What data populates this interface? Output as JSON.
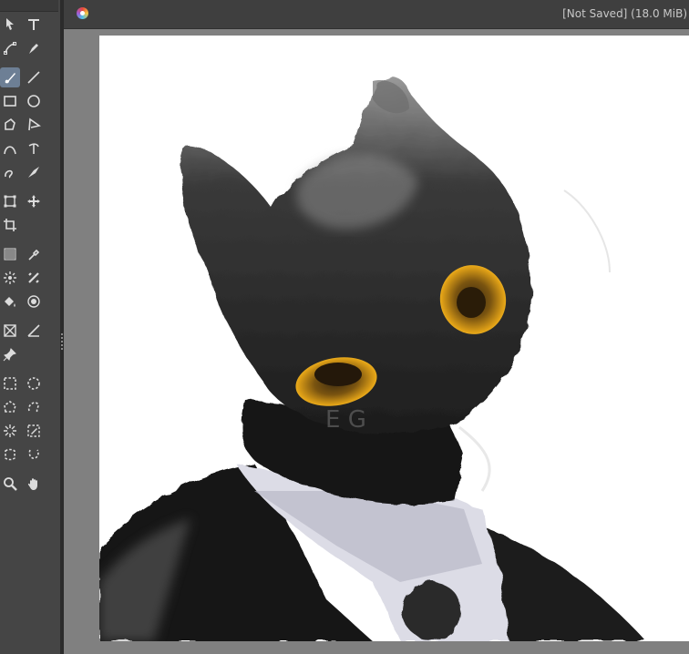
{
  "window": {
    "title": "[Not Saved]  (18.0 MiB)"
  },
  "tools": [
    {
      "name": "move-icon",
      "col": 0,
      "row": 0
    },
    {
      "name": "text-icon",
      "col": 1,
      "row": 0
    },
    {
      "name": "unified-transform-icon",
      "col": 0,
      "row": 1
    },
    {
      "name": "pen-icon",
      "col": 1,
      "row": 1
    },
    {
      "name": "brush-icon",
      "col": 0,
      "row": 2,
      "active": true
    },
    {
      "name": "line-icon",
      "col": 1,
      "row": 2
    },
    {
      "name": "rectangle-icon",
      "col": 0,
      "row": 3
    },
    {
      "name": "ellipse-icon",
      "col": 1,
      "row": 3
    },
    {
      "name": "polygon-icon",
      "col": 0,
      "row": 4
    },
    {
      "name": "polyline-icon",
      "col": 1,
      "row": 4
    },
    {
      "name": "curve-icon",
      "col": 0,
      "row": 5
    },
    {
      "name": "bezier-icon",
      "col": 1,
      "row": 5
    },
    {
      "name": "freehand-icon",
      "col": 0,
      "row": 6
    },
    {
      "name": "dynamic-brush-icon",
      "col": 1,
      "row": 6
    },
    {
      "name": "transform-icon",
      "col": 0,
      "row": 7
    },
    {
      "name": "move-arrows-icon",
      "col": 1,
      "row": 7
    },
    {
      "name": "crop-icon",
      "col": 0,
      "row": 8
    },
    {
      "name": "gradient-icon",
      "col": 0,
      "row": 9
    },
    {
      "name": "color-picker-icon",
      "col": 1,
      "row": 9
    },
    {
      "name": "smart-patch-icon",
      "col": 0,
      "row": 10
    },
    {
      "name": "colorize-icon",
      "col": 1,
      "row": 10
    },
    {
      "name": "fill-icon",
      "col": 0,
      "row": 11
    },
    {
      "name": "enclose-fill-icon",
      "col": 1,
      "row": 11
    },
    {
      "name": "assistant-icon",
      "col": 0,
      "row": 12
    },
    {
      "name": "measure-icon",
      "col": 1,
      "row": 12
    },
    {
      "name": "reference-icon",
      "col": 0,
      "row": 13
    },
    {
      "name": "rect-select-icon",
      "col": 0,
      "row": 14
    },
    {
      "name": "ellipse-select-icon",
      "col": 1,
      "row": 14
    },
    {
      "name": "polygon-select-icon",
      "col": 0,
      "row": 15
    },
    {
      "name": "freehand-select-icon",
      "col": 1,
      "row": 15
    },
    {
      "name": "magic-wand-icon",
      "col": 0,
      "row": 16
    },
    {
      "name": "similar-select-icon",
      "col": 1,
      "row": 16
    },
    {
      "name": "bezier-select-icon",
      "col": 0,
      "row": 17
    },
    {
      "name": "magnetic-select-icon",
      "col": 1,
      "row": 17
    },
    {
      "name": "zoom-icon",
      "col": 0,
      "row": 18
    },
    {
      "name": "pan-icon",
      "col": 1,
      "row": 18
    }
  ]
}
